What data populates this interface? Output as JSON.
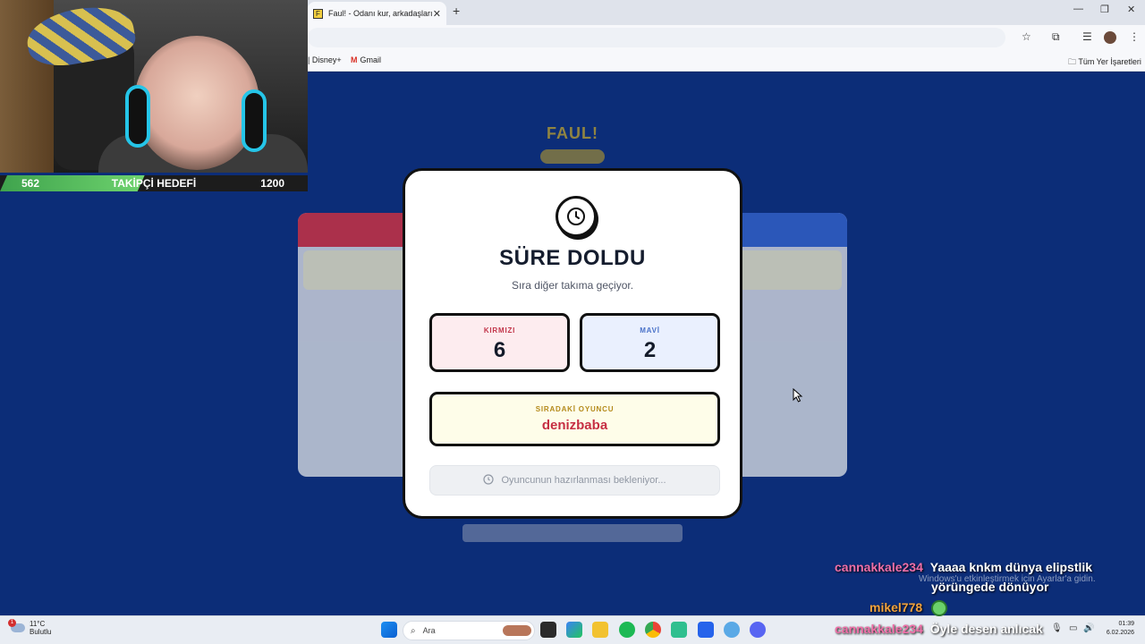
{
  "stream": {
    "goal": {
      "current": "562",
      "title": "TAKİPÇİ HEDEFİ",
      "target": "1200",
      "progress": 0.468
    }
  },
  "browser": {
    "tab_title": "Faul! - Odanı kur, arkadaşlarını",
    "bookmarks": {
      "disney": "| Disney+",
      "gmail": "Gmail",
      "all_bookmarks": "Tüm Yer İşaretleri"
    }
  },
  "game": {
    "logo": "FAUL!"
  },
  "modal": {
    "title": "SÜRE DOLDU",
    "subtitle": "Sıra diğer takıma geçiyor.",
    "red": {
      "label": "KIRMIZI",
      "score": "6"
    },
    "blue": {
      "label": "MAVİ",
      "score": "2"
    },
    "next": {
      "label": "SIRADAKİ OYUNCU",
      "player": "denizbaba"
    },
    "waiting": "Oyuncunun hazırlanması bekleniyor..."
  },
  "chat": [
    {
      "user": "cannakkale234",
      "message": "Yaaaa knkm dünya elipstlik",
      "color": "#f06fa8"
    },
    {
      "user": "",
      "message": "yörüngede dönüyor",
      "color": ""
    },
    {
      "user": "mikel778",
      "message": "",
      "color": "#f3a23b"
    },
    {
      "user": "cannakkale234",
      "message": "Öyle desen anlıcak",
      "color": "#f06fa8"
    }
  ],
  "windows_activation": {
    "line1": "Windows'u etkinleştirmek için Ayarlar'a gidin."
  },
  "taskbar": {
    "weather_temp": "11°C",
    "weather_desc": "Bulutlu",
    "weather_badge": "1",
    "search_placeholder": "Ara",
    "time": "01:39",
    "date": "6.02.2026"
  }
}
